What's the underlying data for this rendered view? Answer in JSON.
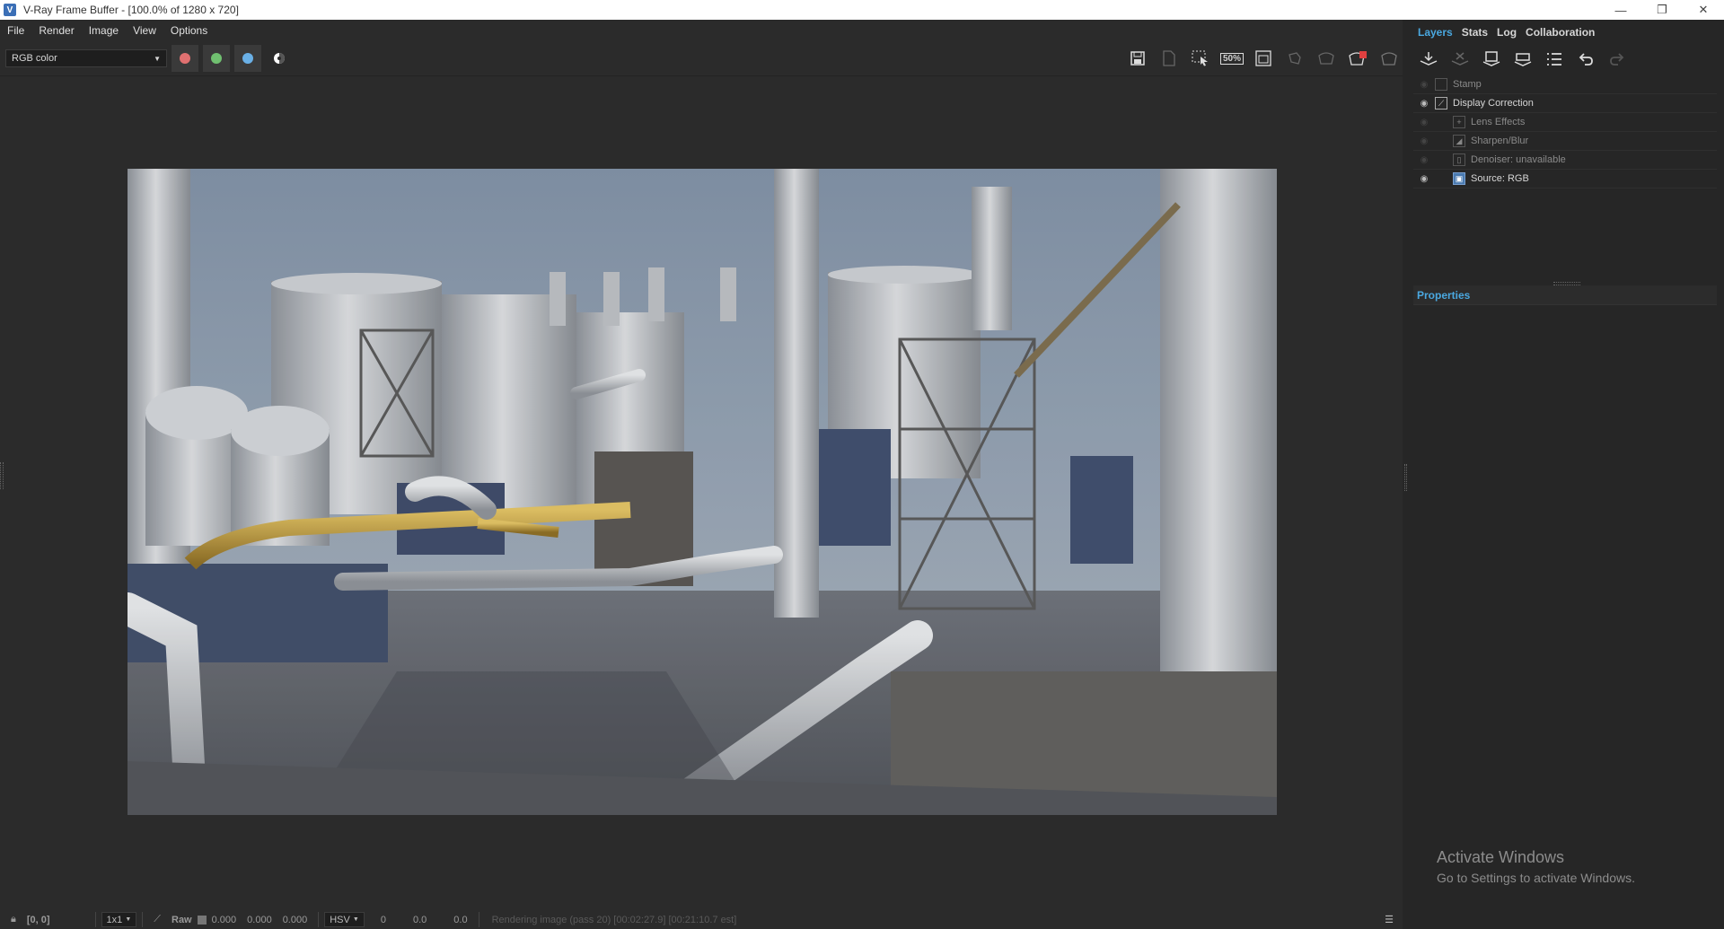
{
  "window": {
    "title": "V-Ray Frame Buffer - [100.0% of 1280 x 720]",
    "minimize": "—",
    "maximize": "❐",
    "close": "✕"
  },
  "menu": [
    "File",
    "Render",
    "Image",
    "View",
    "Options"
  ],
  "toolbar": {
    "channel": "RGB color",
    "channel_colors": {
      "red": "#e07070",
      "green": "#70c070",
      "blue": "#6ab0e6"
    }
  },
  "right_toolbar_icons": [
    "save-icon",
    "clear-image-icon",
    "region-render-icon",
    "zoom-50-icon",
    "render-region-icon",
    "track-mouse-icon",
    "render-interactive-icon",
    "stop-render-icon",
    "render-icon"
  ],
  "zoom_label": "50%",
  "panel": {
    "tabs": [
      "Layers",
      "Stats",
      "Log",
      "Collaboration"
    ],
    "active_tab": "Layers",
    "layers": [
      {
        "name": "Stamp",
        "visible": false,
        "enabled": false
      },
      {
        "name": "Display Correction",
        "visible": true,
        "enabled": true
      },
      {
        "name": "Lens Effects",
        "visible": false,
        "enabled": false
      },
      {
        "name": "Sharpen/Blur",
        "visible": false,
        "enabled": false
      },
      {
        "name": "Denoiser: unavailable",
        "visible": false,
        "enabled": false
      },
      {
        "name": "Source: RGB",
        "visible": true,
        "enabled": true
      }
    ],
    "properties_title": "Properties"
  },
  "activate": {
    "line1": "Activate Windows",
    "line2": "Go to Settings to activate Windows."
  },
  "status": {
    "coords": "[0, 0]",
    "sample": "1x1",
    "mode": "Raw",
    "r": "0.000",
    "g": "0.000",
    "b": "0.000",
    "colorspace": "HSV",
    "h": "0",
    "s": "0.0",
    "v": "0.0",
    "rendering": "Rendering image (pass 20) [00:02:27.9] [00:21:10.7 est]"
  }
}
